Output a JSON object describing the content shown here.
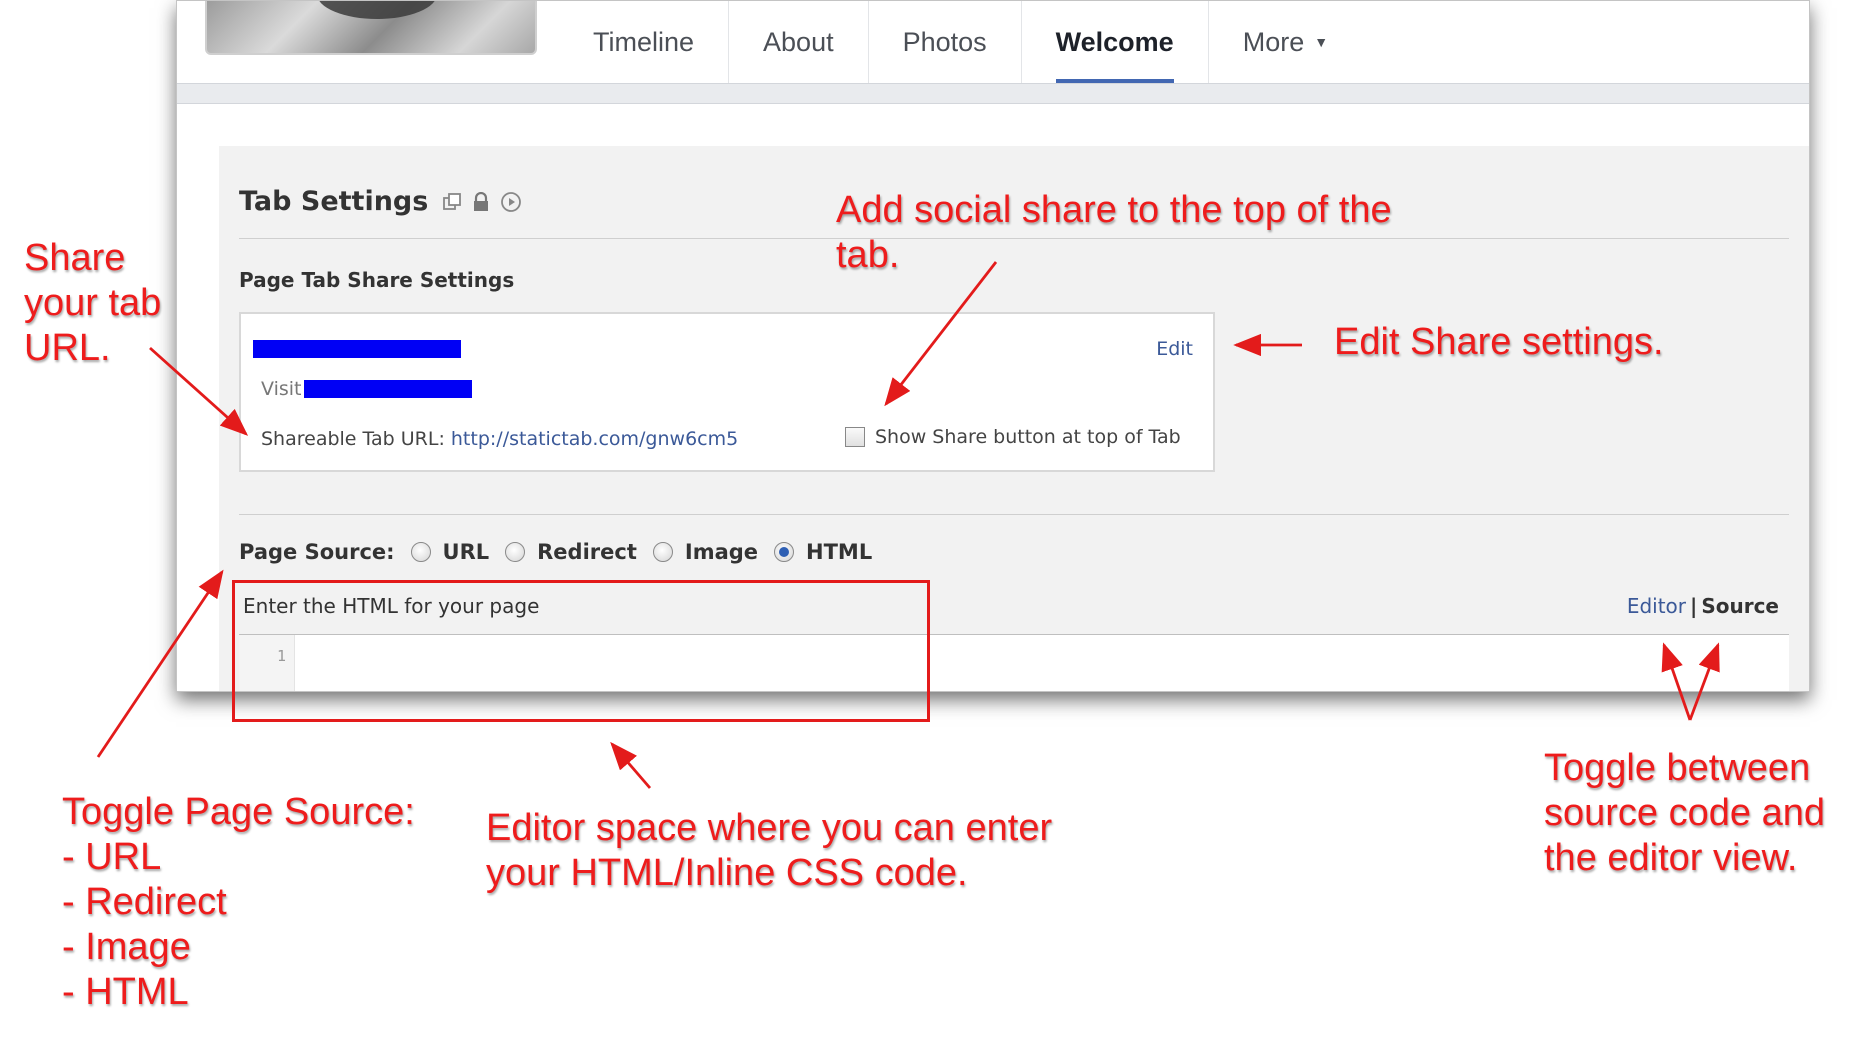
{
  "nav": {
    "tabs": [
      {
        "label": "Timeline"
      },
      {
        "label": "About"
      },
      {
        "label": "Photos"
      },
      {
        "label": "Welcome"
      },
      {
        "label": "More"
      }
    ],
    "active_tab": "Welcome"
  },
  "tab_settings": {
    "title": "Tab Settings",
    "icons": [
      "external-link-icon",
      "lock-icon",
      "play-icon"
    ],
    "share_section_title": "Page Tab Share Settings",
    "visit_label": "Visit",
    "edit_label": "Edit",
    "shareable_label": "Shareable Tab URL:",
    "shareable_url": "http://statictab.com/gnw6cm5",
    "show_share_label": "Show Share button at top of Tab",
    "show_share_checked": false,
    "page_source_label": "Page Source:",
    "source_options": [
      {
        "label": "URL",
        "checked": false
      },
      {
        "label": "Redirect",
        "checked": false
      },
      {
        "label": "Image",
        "checked": false
      },
      {
        "label": "HTML",
        "checked": true
      }
    ],
    "editor_hint": "Enter the HTML for your page",
    "editor_link": "Editor",
    "toggle_separator": "|",
    "source_link": "Source",
    "line_number": "1"
  },
  "annotations": {
    "share_url": "Share\nyour tab\nURL.",
    "social_share": "Add social share to the top of the\ntab.",
    "edit_share": "Edit Share settings.",
    "toggle_source": "Toggle Page Source:\n- URL\n- Redirect\n- Image\n- HTML",
    "editor_space": "Editor space where you can enter\nyour HTML/Inline CSS code.",
    "toggle_view": "Toggle between\nsource code and\nthe editor view."
  },
  "colors": {
    "annotation_red": "#ee1c1c",
    "facebook_blue": "#3b5998",
    "redacted_blue": "#0000f5"
  }
}
